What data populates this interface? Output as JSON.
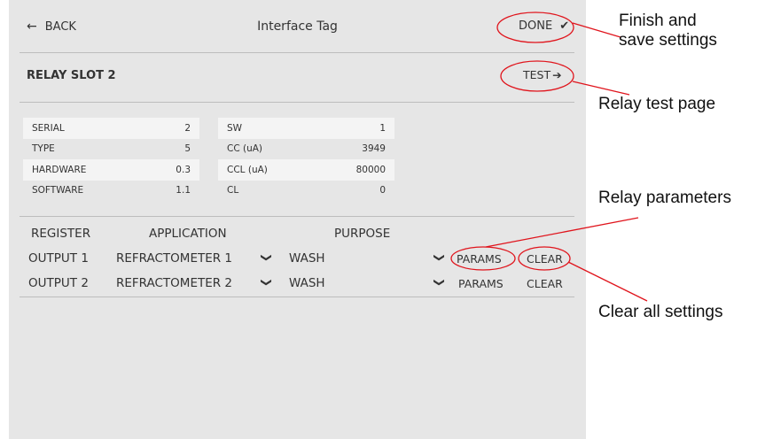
{
  "header": {
    "back_icon": "arrow-left-icon",
    "back_label": "BACK",
    "title": "Interface Tag",
    "done_label": "DONE",
    "done_icon": "checkmark-icon"
  },
  "slot": {
    "title": "RELAY SLOT 2",
    "test_label": "TEST",
    "test_icon": "arrow-right-icon"
  },
  "info_left": [
    {
      "label": "SERIAL",
      "value": "2"
    },
    {
      "label": "TYPE",
      "value": "5"
    },
    {
      "label": "HARDWARE",
      "value": "0.3"
    },
    {
      "label": "SOFTWARE",
      "value": "1.1"
    }
  ],
  "info_right": [
    {
      "label": "SW",
      "value": "1"
    },
    {
      "label": "CC (uA)",
      "value": "3949"
    },
    {
      "label": "CCL (uA)",
      "value": "80000"
    },
    {
      "label": "CL",
      "value": "0"
    }
  ],
  "registers": {
    "headers": {
      "register": "REGISTER",
      "application": "APPLICATION",
      "purpose": "PURPOSE"
    },
    "rows": [
      {
        "register": "OUTPUT 1",
        "application": "REFRACTOMETER 1",
        "purpose": "WASH",
        "params": "PARAMS",
        "clear": "CLEAR"
      },
      {
        "register": "OUTPUT 2",
        "application": "REFRACTOMETER 2",
        "purpose": "WASH",
        "params": "PARAMS",
        "clear": "CLEAR"
      }
    ]
  },
  "annotations": {
    "finish_line1": "Finish and",
    "finish_line2": "save settings",
    "test_page": "Relay test page",
    "parameters": "Relay parameters",
    "clear_all": "Clear all settings",
    "color": "#e0141c"
  }
}
